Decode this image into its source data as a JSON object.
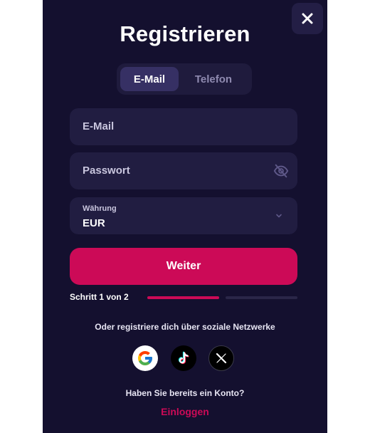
{
  "colors": {
    "background": "#14102f",
    "field": "#211d41",
    "accent": "#cc0a57",
    "text": "#ffffff",
    "muted": "#8f8ab0"
  },
  "close_icon": "close-icon",
  "title": "Registrieren",
  "tabs": [
    {
      "label": "E-Mail",
      "active": true
    },
    {
      "label": "Telefon",
      "active": false
    }
  ],
  "form": {
    "email_placeholder": "E-Mail",
    "password_placeholder": "Passwort",
    "password_icon": "eye-off-icon",
    "currency": {
      "label": "Währung",
      "value": "EUR",
      "icon": "chevron-down-icon"
    }
  },
  "submit_label": "Weiter",
  "progress": {
    "text": "Schritt 1 von 2",
    "current_step": 1,
    "total_steps": 2
  },
  "social": {
    "prompt": "Oder registriere dich über soziale Netzwerke",
    "providers": [
      "google-icon",
      "tiktok-icon",
      "x-icon"
    ]
  },
  "account": {
    "question": "Haben Sie bereits ein Konto?",
    "login_label": "Einloggen"
  }
}
